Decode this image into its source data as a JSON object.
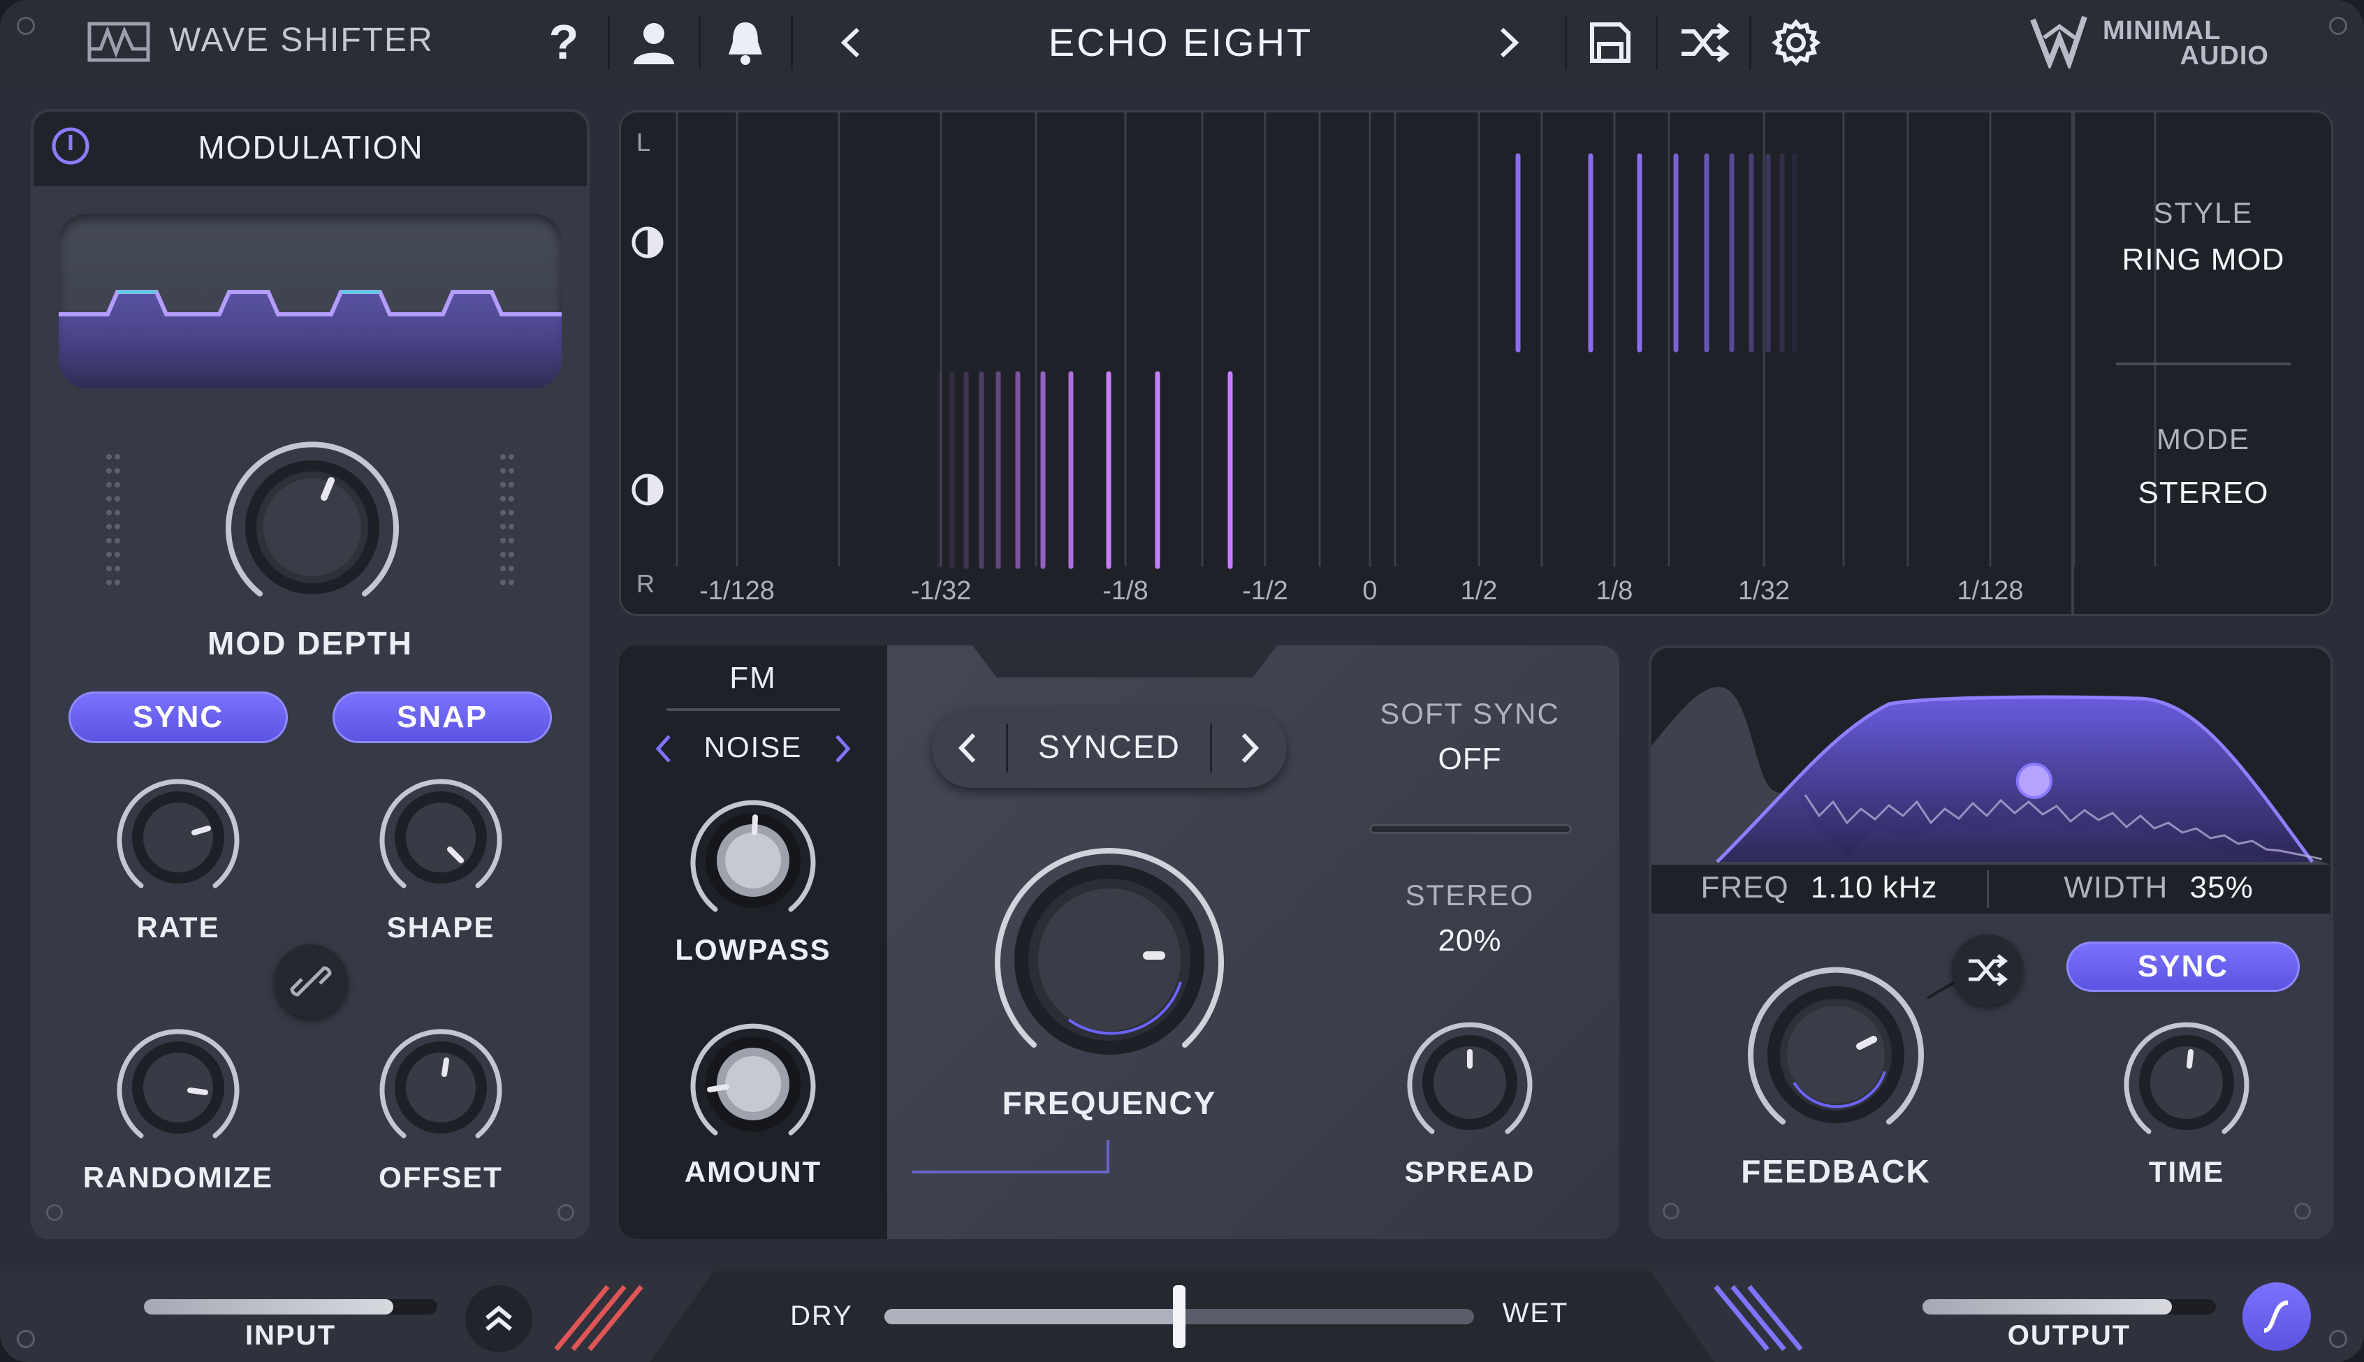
{
  "header": {
    "product": "WAVE SHIFTER",
    "preset": "ECHO EIGHT",
    "brand_line1": "MINIMAL",
    "brand_line2": "AUDIO",
    "icons": [
      "logo-wave-icon",
      "help-icon",
      "user-icon",
      "bell-icon",
      "chevron-left-icon",
      "chevron-right-icon",
      "save-icon",
      "shuffle-icon",
      "gear-icon",
      "brand-logo-icon"
    ]
  },
  "modulation": {
    "title": "MODULATION",
    "mod_depth_label": "MOD DEPTH",
    "sync_label": "SYNC",
    "snap_label": "SNAP",
    "rate_label": "RATE",
    "shape_label": "SHAPE",
    "randomize_label": "RANDOMIZE",
    "offset_label": "OFFSET"
  },
  "display": {
    "channel_top": "L",
    "channel_bottom": "R",
    "ticks": [
      "-1/128",
      "-1/32",
      "-1/8",
      "-1/2",
      "0",
      "1/2",
      "1/8",
      "1/32",
      "1/128"
    ],
    "style_title": "STYLE",
    "style_value": "RING MOD",
    "mode_title": "MODE",
    "mode_value": "STEREO"
  },
  "fm": {
    "title": "FM",
    "source": "NOISE",
    "lowpass_label": "LOWPASS",
    "amount_label": "AMOUNT"
  },
  "center": {
    "mode": "SYNCED",
    "frequency_label": "FREQUENCY",
    "soft_sync_title": "SOFT SYNC",
    "soft_sync_value": "OFF",
    "stereo_title": "STEREO",
    "stereo_value": "20%",
    "spread_label": "SPREAD"
  },
  "filter": {
    "freq_title": "FREQ",
    "freq_value": "1.10 kHz",
    "width_title": "WIDTH",
    "width_value": "35%",
    "sync_label": "SYNC",
    "feedback_label": "FEEDBACK",
    "time_label": "TIME"
  },
  "footer": {
    "input_label": "INPUT",
    "dry_label": "DRY",
    "wet_label": "WET",
    "output_label": "OUTPUT",
    "dry_wet": 0.5,
    "input_level": 0.85,
    "output_level": 0.85
  },
  "colors": {
    "accent": "#6c63ff",
    "accent_light": "#9b8cff",
    "pink": "#c77dff",
    "background": "#2b2e38",
    "panel": "#363a46",
    "dark": "#1f2128"
  }
}
